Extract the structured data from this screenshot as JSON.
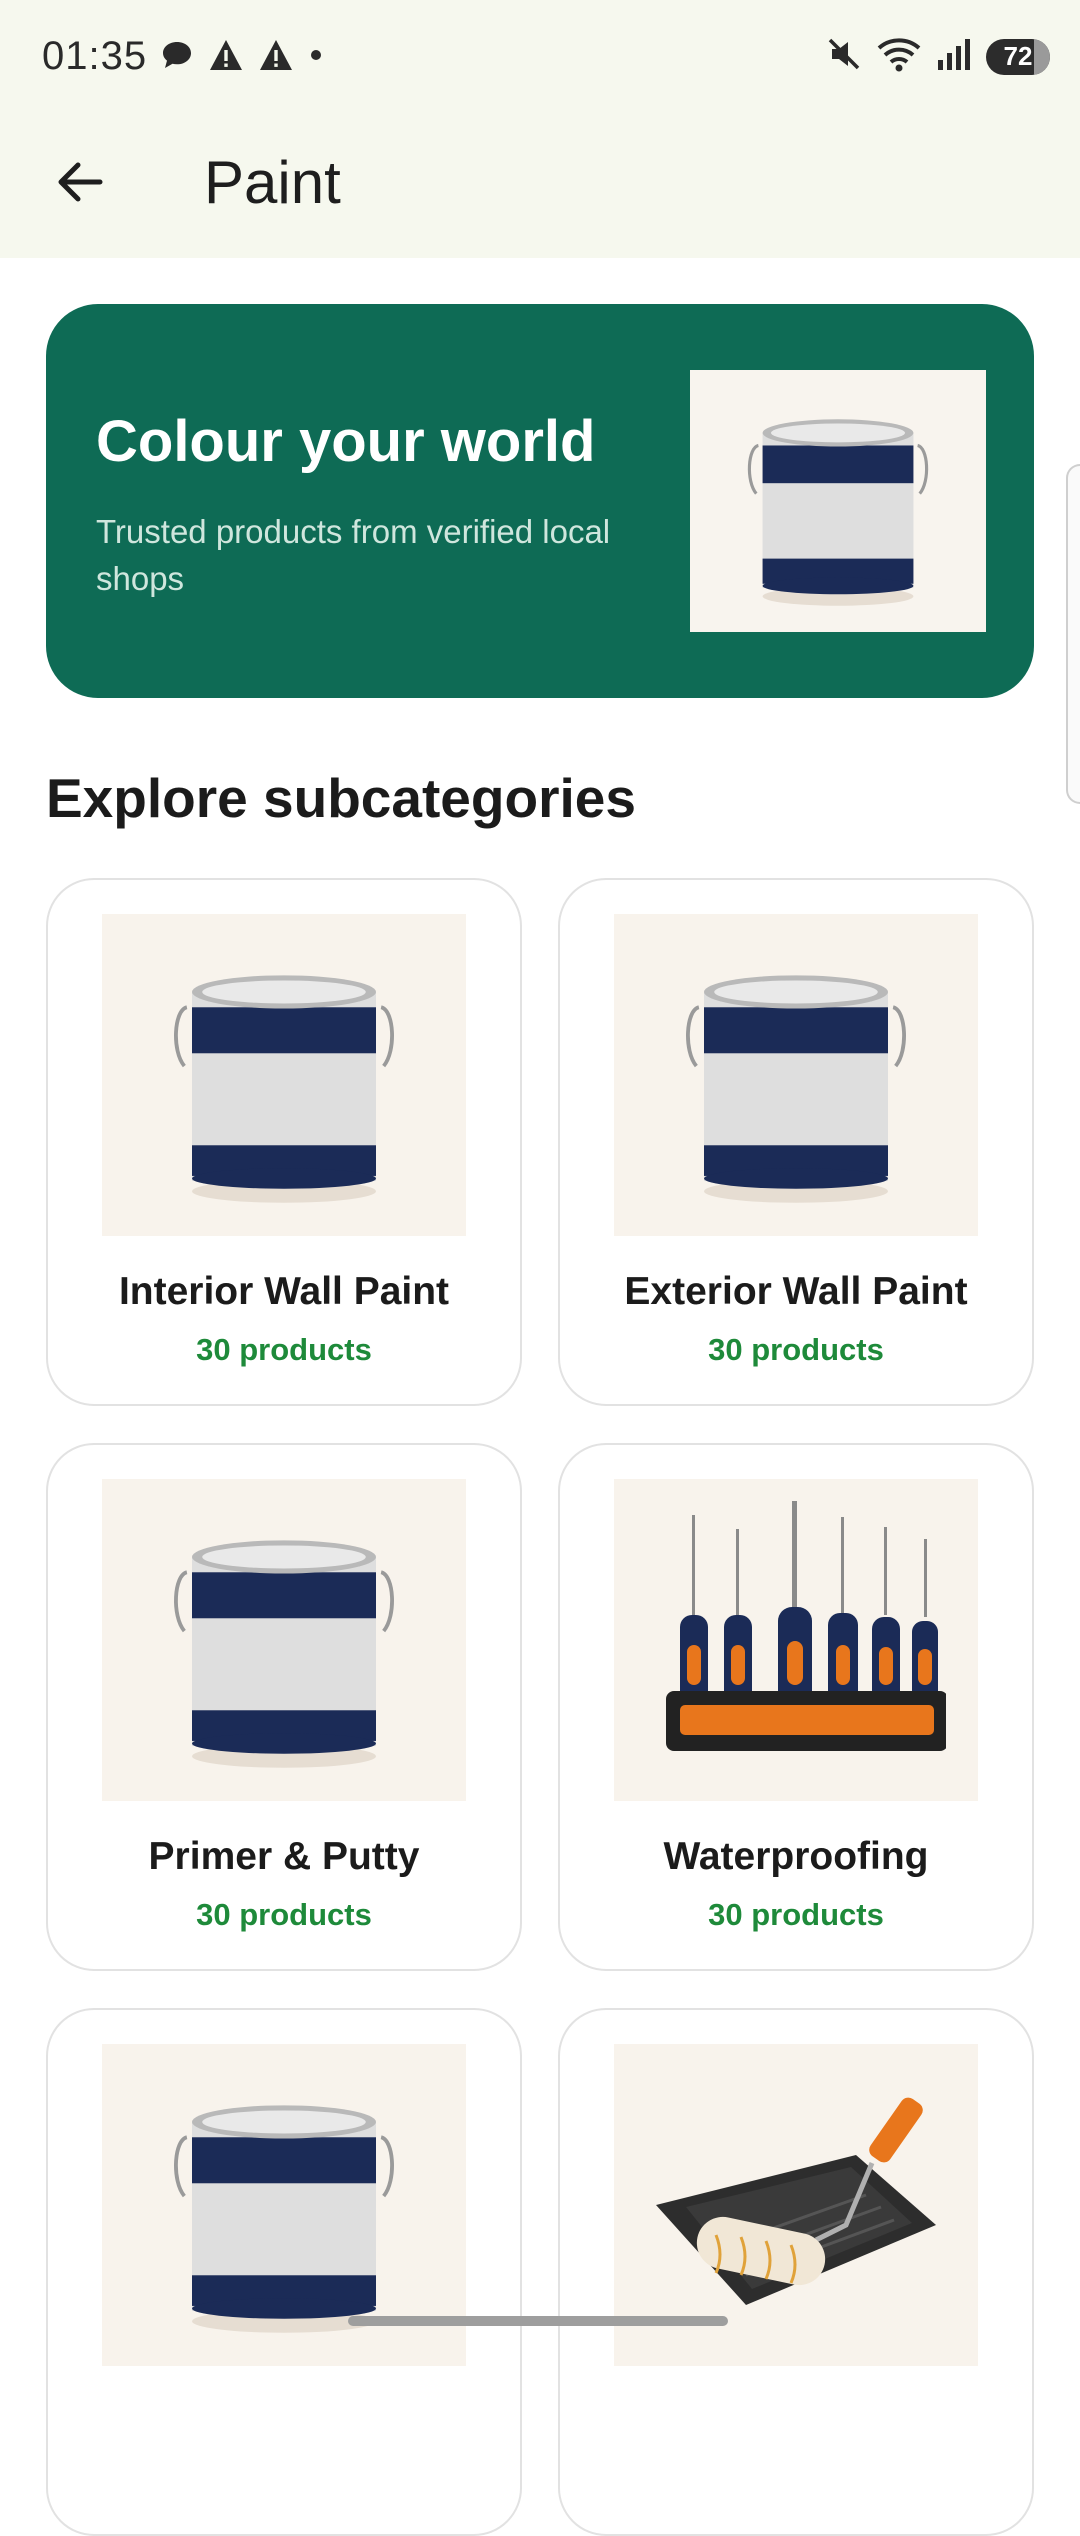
{
  "status_bar": {
    "time": "01:35",
    "battery": "72",
    "icons_left": [
      "chat-bubble-icon",
      "warning-icon",
      "warning-icon",
      "dot-icon"
    ],
    "icons_right": [
      "mute-icon",
      "wifi-icon",
      "signal-icon",
      "battery-icon"
    ]
  },
  "app_bar": {
    "title": "Paint",
    "back_icon": "arrow-left-icon"
  },
  "hero": {
    "title": "Colour your world",
    "subtitle": "Trusted products from verified local shops",
    "image_icon": "paint-can-icon",
    "background": "#0e6b55"
  },
  "section": {
    "title": "Explore subcategories"
  },
  "subcategories": [
    {
      "name": "Interior Wall Paint",
      "count": "30 products",
      "image_icon": "paint-can-icon"
    },
    {
      "name": "Exterior Wall Paint",
      "count": "30 products",
      "image_icon": "paint-can-icon"
    },
    {
      "name": "Primer & Putty",
      "count": "30 products",
      "image_icon": "paint-can-icon"
    },
    {
      "name": "Waterproofing",
      "count": "30 products",
      "image_icon": "screwdriver-set-icon"
    },
    {
      "name": "",
      "count": "",
      "image_icon": "paint-can-icon"
    },
    {
      "name": "",
      "count": "",
      "image_icon": "paint-roller-tray-icon"
    }
  ],
  "colors": {
    "accent_green": "#1e8a3a",
    "banner_green": "#0e6b55",
    "can_navy": "#1b2b57"
  }
}
